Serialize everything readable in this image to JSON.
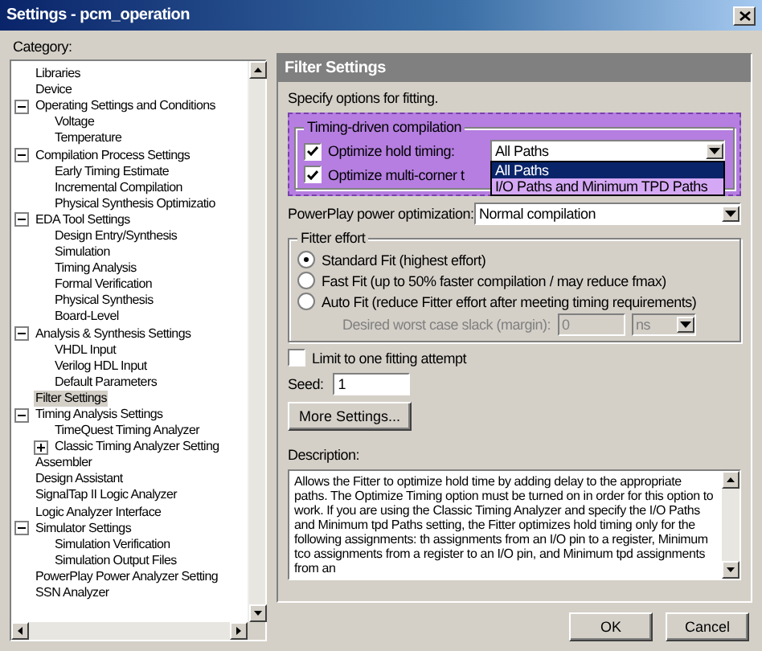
{
  "window": {
    "title": "Settings - pcm_operation"
  },
  "category_label": "Category:",
  "tree": [
    {
      "label": "Libraries",
      "selected": false
    },
    {
      "label": "Device",
      "selected": false
    },
    {
      "label": "Operating Settings and Conditions",
      "selected": false,
      "expanded": true,
      "children": [
        {
          "label": "Voltage",
          "selected": false
        },
        {
          "label": "Temperature",
          "selected": false
        }
      ]
    },
    {
      "label": "Compilation Process Settings",
      "selected": false,
      "expanded": true,
      "children": [
        {
          "label": "Early Timing Estimate",
          "selected": false
        },
        {
          "label": "Incremental Compilation",
          "selected": false
        },
        {
          "label": "Physical Synthesis Optimizatio",
          "selected": false
        }
      ]
    },
    {
      "label": "EDA Tool Settings",
      "selected": false,
      "expanded": true,
      "children": [
        {
          "label": "Design Entry/Synthesis",
          "selected": false
        },
        {
          "label": "Simulation",
          "selected": false
        },
        {
          "label": "Timing Analysis",
          "selected": false
        },
        {
          "label": "Formal Verification",
          "selected": false
        },
        {
          "label": "Physical Synthesis",
          "selected": false
        },
        {
          "label": "Board-Level",
          "selected": false
        }
      ]
    },
    {
      "label": "Analysis & Synthesis Settings",
      "selected": false,
      "expanded": true,
      "children": [
        {
          "label": "VHDL Input",
          "selected": false
        },
        {
          "label": "Verilog HDL Input",
          "selected": false
        },
        {
          "label": "Default Parameters",
          "selected": false
        }
      ]
    },
    {
      "label": "Filter Settings",
      "selected": true
    },
    {
      "label": "Timing Analysis Settings",
      "selected": false,
      "expanded": true,
      "children": [
        {
          "label": "TimeQuest Timing Analyzer",
          "selected": false
        },
        {
          "label": "Classic Timing Analyzer Setting",
          "selected": false,
          "expanded": false
        }
      ]
    },
    {
      "label": "Assembler",
      "selected": false
    },
    {
      "label": "Design Assistant",
      "selected": false
    },
    {
      "label": "SignalTap II Logic Analyzer",
      "selected": false
    },
    {
      "label": "Logic Analyzer Interface",
      "selected": false
    },
    {
      "label": "Simulator Settings",
      "selected": false,
      "expanded": true,
      "children": [
        {
          "label": "Simulation Verification",
          "selected": false
        },
        {
          "label": "Simulation Output Files",
          "selected": false
        }
      ]
    },
    {
      "label": "PowerPlay Power Analyzer Setting",
      "selected": false
    },
    {
      "label": "SSN Analyzer",
      "selected": false
    }
  ],
  "panel": {
    "title": "Filter Settings",
    "intro": "Specify options for fitting.",
    "timing_group": {
      "title": "Timing-driven compilation",
      "hold_timing": {
        "label": "Optimize hold timing:",
        "checked": true,
        "value": "All Paths",
        "options": [
          {
            "label": "All Paths",
            "selected": true
          },
          {
            "label": "I/O Paths and Minimum TPD Paths",
            "selected": false
          }
        ]
      },
      "multi_corner": {
        "label": "Optimize multi-corner t",
        "checked": true
      }
    },
    "power": {
      "label": "PowerPlay power optimization:",
      "value": "Normal compilation"
    },
    "effort_group": {
      "title": "Fitter effort",
      "options": [
        {
          "label": "Standard Fit (highest effort)",
          "selected": true
        },
        {
          "label": "Fast Fit (up to 50% faster compilation / may reduce fmax)",
          "selected": false
        },
        {
          "label": "Auto Fit (reduce Fitter effort after meeting timing requirements)",
          "selected": false
        }
      ],
      "slack": {
        "label": "Desired worst case slack (margin):",
        "value": "0",
        "unit": "ns",
        "disabled": true
      }
    },
    "limit": {
      "label": "Limit to one fitting attempt",
      "checked": false
    },
    "seed": {
      "label": "Seed:",
      "value": "1"
    },
    "more_button": "More Settings...",
    "description": {
      "label": "Description:",
      "text": "Allows the Fitter to optimize hold time by adding delay to the appropriate paths. The Optimize Timing option must be turned on in order for this option to work. If you are using the Classic Timing Analyzer and specify the I/O Paths and Minimum tpd Paths setting, the Fitter optimizes hold timing only for the following assignments: th assignments from an I/O pin to a register, Minimum tco assignments from a register to an I/O pin, and Minimum tpd assignments from an"
    }
  },
  "buttons": [
    {
      "label": "OK"
    },
    {
      "label": "Cancel"
    }
  ]
}
